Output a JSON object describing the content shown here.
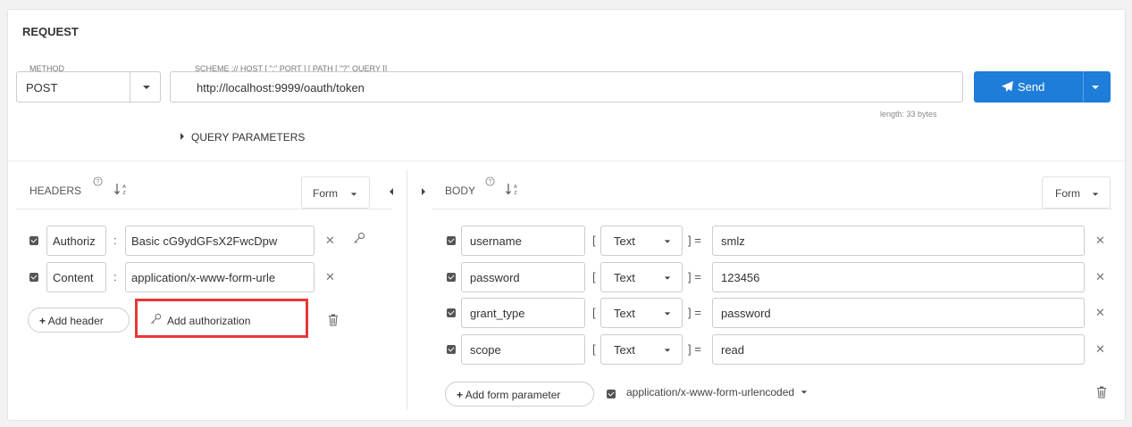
{
  "request": {
    "title": "REQUEST",
    "method_label": "METHOD",
    "method_value": "POST",
    "url_label": "SCHEME :// HOST [ \":\" PORT ] [ PATH [ \"?\" QUERY ]]",
    "url_value": "http://localhost:9999/oauth/token",
    "send_label": "Send",
    "length_text": "length: 33 bytes",
    "query_params_label": "QUERY PARAMETERS"
  },
  "headers": {
    "label": "HEADERS",
    "form_label": "Form",
    "rows": [
      {
        "key": "Authoriz",
        "value": "Basic cG9ydGFsX2FwcDpw"
      },
      {
        "key": "Content",
        "value": "application/x-www-form-urle"
      }
    ],
    "add_header_label": "Add header",
    "add_authorization_label": "Add authorization"
  },
  "body": {
    "label": "BODY",
    "form_label": "Form",
    "rows": [
      {
        "name": "username",
        "type": "Text",
        "value": "smlz"
      },
      {
        "name": "password",
        "type": "Text",
        "value": "123456"
      },
      {
        "name": "grant_type",
        "type": "Text",
        "value": "password"
      },
      {
        "name": "scope",
        "type": "Text",
        "value": "read"
      }
    ],
    "add_param_label": "Add form parameter",
    "content_type": "application/x-www-form-urlencoded"
  },
  "colors": {
    "accent": "#1e7dd8",
    "highlight": "#e53935"
  }
}
